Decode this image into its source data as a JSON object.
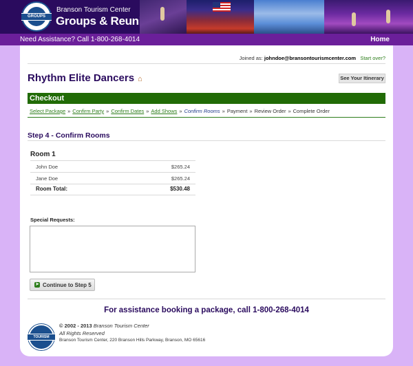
{
  "header": {
    "logo_badge": "GROUPS",
    "brand_small": "Branson Tourism Center",
    "brand_big": "Groups & Reunion Planner"
  },
  "topnav": {
    "assistance": "Need Assistance? Call 1-800-268-4014",
    "home": "Home"
  },
  "account": {
    "joined_label": "Joined as:",
    "email": "johndoe@bransontourismcenter.com",
    "start_over": "Start over?"
  },
  "party": {
    "name": "Rhythm Elite Dancers",
    "itinerary_button": "See Your Itinerary"
  },
  "checkout": {
    "title": "Checkout",
    "steps": [
      {
        "label": "Select Package",
        "state": "done"
      },
      {
        "label": "Confirm Party",
        "state": "done"
      },
      {
        "label": "Confirm Dates",
        "state": "done"
      },
      {
        "label": "Add Shows",
        "state": "done"
      },
      {
        "label": "Confirm Rooms",
        "state": "current"
      },
      {
        "label": "Payment",
        "state": "pending"
      },
      {
        "label": "Review Order",
        "state": "pending"
      },
      {
        "label": "Complete Order",
        "state": "pending"
      }
    ],
    "separator": "»"
  },
  "step": {
    "title": "Step 4 - Confirm Rooms",
    "room": {
      "title": "Room 1",
      "occupants": [
        {
          "name": "John Doe",
          "price": "$265.24"
        },
        {
          "name": "Jane Doe",
          "price": "$265.24"
        }
      ],
      "total_label": "Room Total:",
      "total_value": "$530.48"
    },
    "special_requests_label": "Special Requests:",
    "special_requests_value": "",
    "continue_button": "Continue to Step 5"
  },
  "footer": {
    "assistance": "For assistance booking a package, call 1-800-268-4014",
    "logo_badge": "TOURISM",
    "copyright_years": "© 2002 - 2013",
    "copyright_org": "Branson Tourism Center",
    "rights": "All Rights Reserved",
    "address": "Branson Tourism Center, 220 Branson Hills Parkway, Branson, MO 65616"
  },
  "colors": {
    "page_bg": "#d9b3f7",
    "header_bg": "#2a0b5e",
    "nav_bg": "#6b1f9a",
    "checkout_green": "#216b06",
    "link_green": "#2c7d1a",
    "title_purple": "#2a0b5e"
  }
}
